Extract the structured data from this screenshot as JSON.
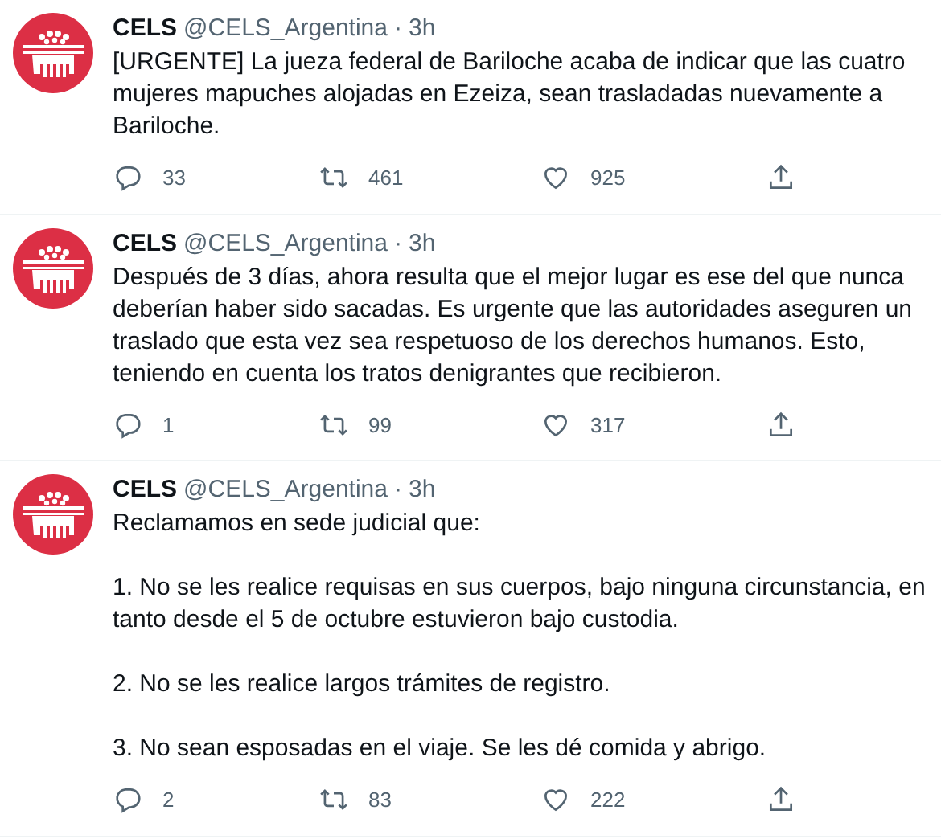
{
  "tweets": [
    {
      "name": "CELS",
      "handle": "@CELS_Argentina",
      "separator": "·",
      "time": "3h",
      "paragraphs": [
        "[URGENTE] La jueza federal de Bariloche acaba de indicar que las cuatro mujeres mapuches alojadas en Ezeiza, sean trasladadas nuevamente a Bariloche."
      ],
      "replies": "33",
      "retweets": "461",
      "likes": "925"
    },
    {
      "name": "CELS",
      "handle": "@CELS_Argentina",
      "separator": "·",
      "time": "3h",
      "paragraphs": [
        "Después de 3 días, ahora resulta que el mejor lugar es ese del que nunca deberían haber sido sacadas. Es urgente que las autoridades aseguren un traslado que esta vez sea respetuoso de los derechos humanos. Esto, teniendo en cuenta los tratos denigrantes que recibieron."
      ],
      "replies": "1",
      "retweets": "99",
      "likes": "317"
    },
    {
      "name": "CELS",
      "handle": "@CELS_Argentina",
      "separator": "·",
      "time": "3h",
      "paragraphs": [
        "Reclamamos en sede judicial que:",
        "1. No se les realice requisas en sus cuerpos, bajo ninguna circunstancia, en tanto desde el 5 de octubre estuvieron bajo custodia.",
        "2. No se les realice largos trámites de registro.",
        "3. No sean esposadas en el viaje. Se les dé comida y abrigo."
      ],
      "replies": "2",
      "retweets": "83",
      "likes": "222"
    }
  ]
}
